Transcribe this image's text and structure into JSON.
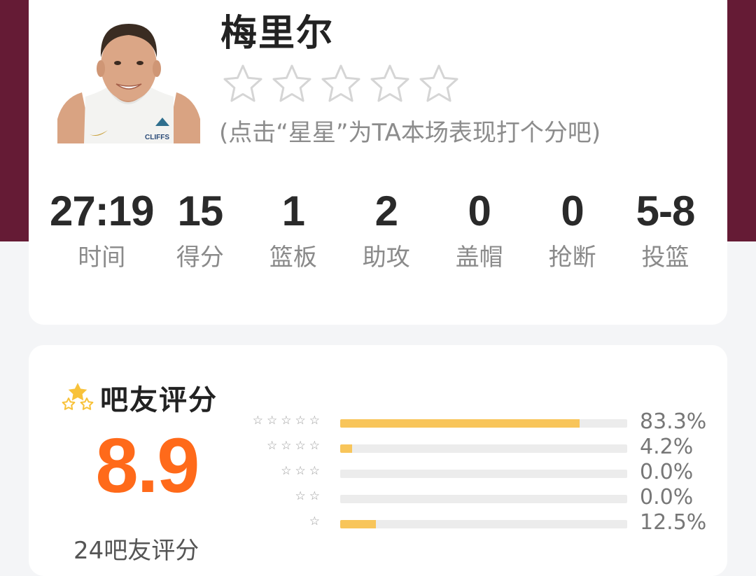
{
  "player": {
    "name": "梅里尔",
    "hint": "(点击“星星”为TA本场表现打个分吧)",
    "jersey_text": "CLIFFS"
  },
  "stats": [
    {
      "value": "27:19",
      "label": "时间"
    },
    {
      "value": "15",
      "label": "得分"
    },
    {
      "value": "1",
      "label": "篮板"
    },
    {
      "value": "2",
      "label": "助攻"
    },
    {
      "value": "0",
      "label": "盖帽"
    },
    {
      "value": "0",
      "label": "抢断"
    },
    {
      "value": "5-8",
      "label": "投篮"
    }
  ],
  "rating": {
    "title": "吧友评分",
    "score": "8.9",
    "voters": "24吧友评分",
    "distribution": [
      {
        "stars": "☆☆☆☆☆",
        "fraction": 0.833,
        "percent": "83.3%"
      },
      {
        "stars": "☆☆☆☆",
        "fraction": 0.042,
        "percent": "4.2%"
      },
      {
        "stars": "☆☆☆",
        "fraction": 0.0,
        "percent": "0.0%"
      },
      {
        "stars": "☆☆",
        "fraction": 0.0,
        "percent": "0.0%"
      },
      {
        "stars": "☆",
        "fraction": 0.125,
        "percent": "12.5%"
      }
    ]
  },
  "colors": {
    "header_bg": "#651b35",
    "score": "#ff6a1a",
    "bar_fill": "#f8c55a",
    "bar_track": "#ececec"
  }
}
